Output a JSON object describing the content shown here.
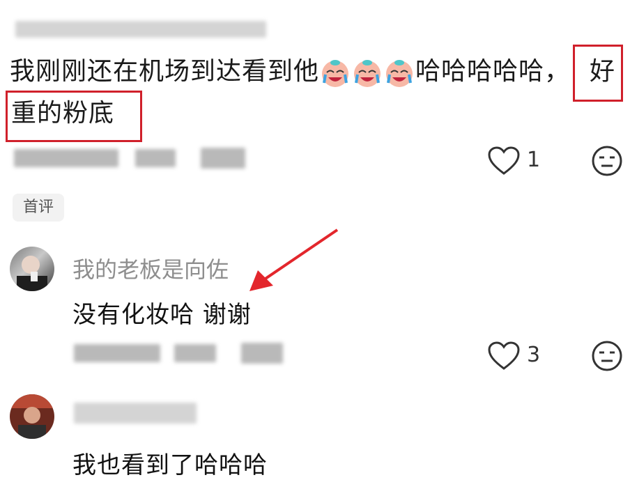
{
  "comment1": {
    "text_part1": "我刚刚还在机场到达看到他",
    "emoji_name": "crying-laughing-baby-emoji",
    "text_part2": "哈哈哈哈哈，",
    "text_highlight_1": "好",
    "text_line2": "重的粉底",
    "like_count": "1"
  },
  "badge": {
    "label": "首评"
  },
  "reply1": {
    "username": "我的老板是向佐",
    "text": "没有化妆哈 谢谢",
    "like_count": "3"
  },
  "reply2": {
    "text": "我也看到了哈哈哈"
  },
  "colors": {
    "highlight_red": "#d0202b",
    "arrow_red": "#e3262c",
    "username_gray": "#8e8e8e"
  },
  "icons": [
    "heart-outline-icon",
    "neutral-face-icon",
    "red-arrow-annotation"
  ]
}
